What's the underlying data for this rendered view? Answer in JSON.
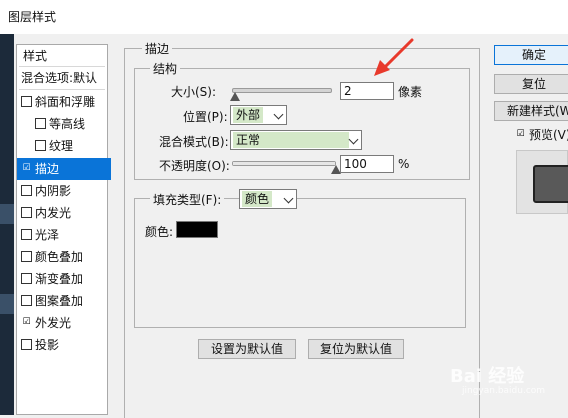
{
  "window": {
    "title": "图层样式"
  },
  "stylelist": {
    "header": "样式",
    "blend_item": "混合选项:默认",
    "items": [
      {
        "label": "斜面和浮雕",
        "checked": false
      },
      {
        "label": "等高线",
        "checked": false
      },
      {
        "label": "纹理",
        "checked": false
      },
      {
        "label": "描边",
        "checked": true
      },
      {
        "label": "内阴影",
        "checked": false
      },
      {
        "label": "内发光",
        "checked": false
      },
      {
        "label": "光泽",
        "checked": false
      },
      {
        "label": "颜色叠加",
        "checked": false
      },
      {
        "label": "渐变叠加",
        "checked": false
      },
      {
        "label": "图案叠加",
        "checked": false
      },
      {
        "label": "外发光",
        "checked": true
      },
      {
        "label": "投影",
        "checked": false
      }
    ],
    "check_mark": "☑"
  },
  "stroke": {
    "group_title": "描边",
    "structure_title": "结构",
    "size_label": "大小(S):",
    "size_value": "2",
    "size_unit": "像素",
    "position_label": "位置(P):",
    "position_value": "外部",
    "blend_label": "混合模式(B):",
    "blend_value": "正常",
    "opacity_label": "不透明度(O):",
    "opacity_value": "100",
    "opacity_unit": "%",
    "fill_type_label": "填充类型(F):",
    "fill_type_value": "颜色",
    "color_label": "颜色:",
    "color_swatch": "#000000"
  },
  "buttons": {
    "set_default": "设置为默认值",
    "reset_default": "复位为默认值",
    "ok": "确定",
    "reset": "复位",
    "new_style": "新建样式(W)...",
    "preview_label": "预览(V)",
    "preview_checked": true
  },
  "watermark": {
    "text": "Bai 经验",
    "sub": "jingyan.baidu.com"
  },
  "colors": {
    "selection": "#0a74d8",
    "annotation_arrow": "#e8392b"
  }
}
